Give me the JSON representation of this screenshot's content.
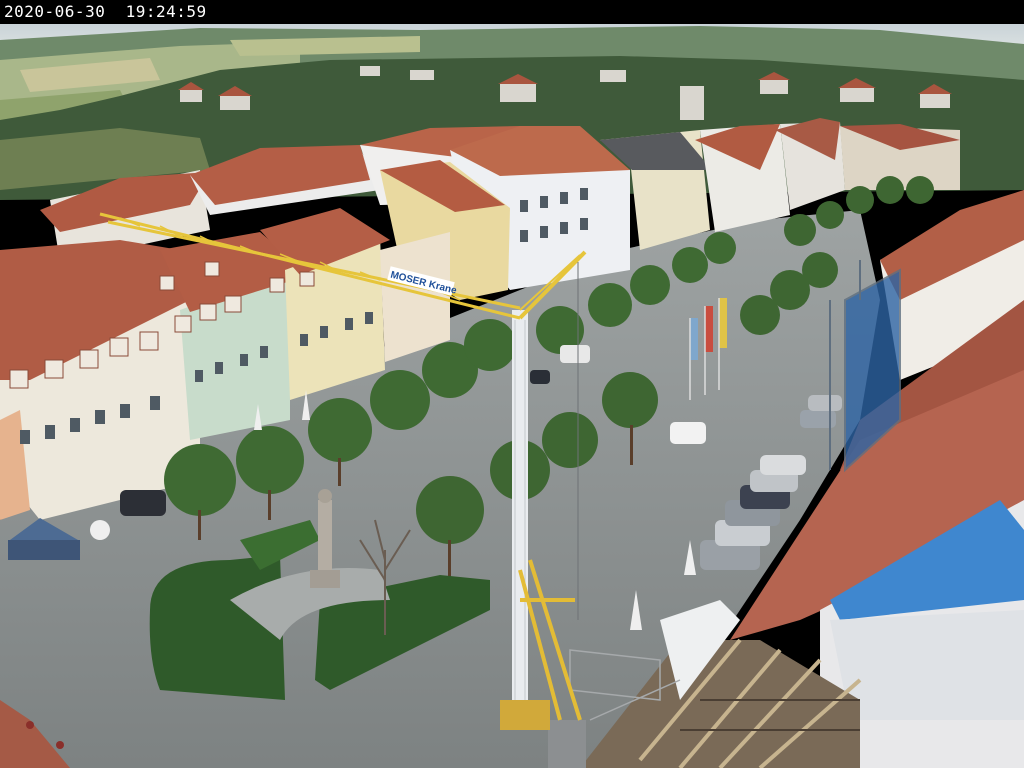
{
  "camera": {
    "timestamp": "2020-06-30  19:24:59"
  },
  "scene": {
    "crane_sign": "MOSER Krane"
  }
}
